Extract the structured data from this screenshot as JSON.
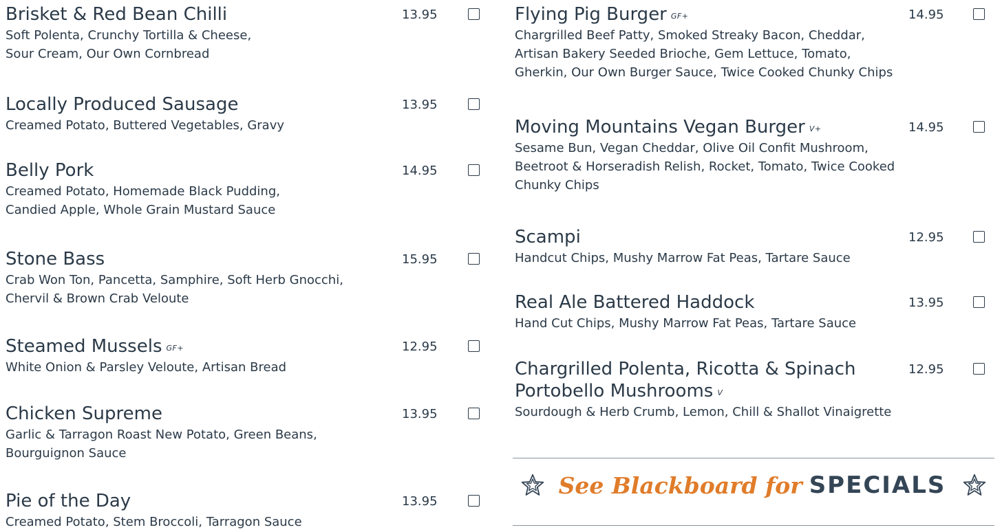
{
  "colors": {
    "text": "#2b3a48",
    "accent_orange": "#e07c2a",
    "heading_dark": "#344556",
    "rule": "#8a949c"
  },
  "left_items": [
    {
      "name": "Brisket & Red Bean Chilli",
      "diet": "",
      "price": "13.95",
      "desc": [
        "Soft Polenta, Crunchy Tortilla & Cheese,",
        "Sour Cream, Our Own Cornbread"
      ]
    },
    {
      "name": "Locally Produced Sausage",
      "diet": "",
      "price": "13.95",
      "desc": [
        "Creamed Potato, Buttered Vegetables, Gravy"
      ]
    },
    {
      "name": "Belly Pork",
      "diet": "",
      "price": "14.95",
      "desc": [
        "Creamed Potato, Homemade Black Pudding,",
        "Candied Apple, Whole Grain Mustard Sauce"
      ]
    },
    {
      "name": "Stone Bass",
      "diet": "",
      "price": "15.95",
      "desc": [
        "Crab Won Ton, Pancetta, Samphire, Soft Herb Gnocchi,",
        "Chervil & Brown Crab Veloute"
      ]
    },
    {
      "name": "Steamed Mussels",
      "diet": "GF+",
      "price": "12.95",
      "desc": [
        "White Onion & Parsley Veloute, Artisan Bread"
      ]
    },
    {
      "name": "Chicken Supreme",
      "diet": "",
      "price": "13.95",
      "desc": [
        "Garlic & Tarragon Roast New Potato, Green Beans,",
        "Bourguignon Sauce"
      ]
    },
    {
      "name": "Pie of the Day",
      "diet": "",
      "price": "13.95",
      "desc": [
        "Creamed Potato, Stem Broccoli, Tarragon Sauce"
      ]
    }
  ],
  "right_items": [
    {
      "name": "Flying Pig Burger",
      "diet": "GF+",
      "price": "14.95",
      "desc": [
        "Chargrilled Beef Patty, Smoked Streaky Bacon, Cheddar,",
        "Artisan Bakery Seeded Brioche, Gem Lettuce, Tomato,",
        "Gherkin, Our Own Burger Sauce, Twice Cooked Chunky Chips"
      ]
    },
    {
      "name": "Moving Mountains Vegan Burger",
      "diet": "V+",
      "price": "14.95",
      "desc": [
        "Sesame Bun, Vegan Cheddar, Olive Oil Confit Mushroom,",
        "Beetroot & Horseradish Relish, Rocket, Tomato, Twice Cooked",
        "Chunky Chips"
      ]
    },
    {
      "name": "Scampi",
      "diet": "",
      "price": "12.95",
      "desc": [
        "Handcut Chips, Mushy Marrow Fat Peas, Tartare Sauce"
      ]
    },
    {
      "name": "Real Ale Battered Haddock",
      "diet": "",
      "price": "13.95",
      "desc": [
        "Hand Cut Chips, Mushy Marrow Fat Peas, Tartare Sauce"
      ]
    },
    {
      "name": "Chargrilled Polenta, Ricotta & Spinach",
      "name_line2": "Portobello Mushrooms",
      "diet": "V",
      "price": "12.95",
      "desc": [
        "Sourdough & Herb Crumb, Lemon, Chill & Shallot Vinaigrette"
      ]
    }
  ],
  "specials": {
    "script_text": "See Blackboard for",
    "bold_text": "SPECIALS",
    "icon": "star-outline-icon"
  }
}
